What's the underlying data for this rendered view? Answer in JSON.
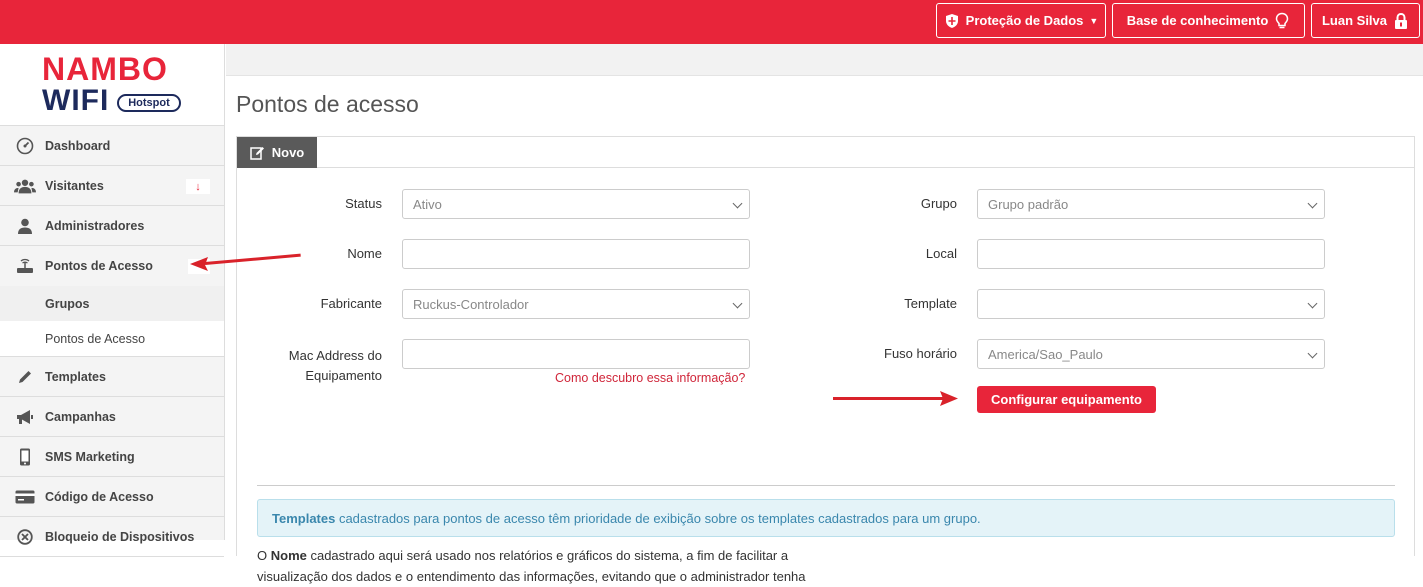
{
  "topbar": {
    "protecao_label": "Proteção de Dados",
    "base_label": "Base de conhecimento",
    "user_label": "Luan Silva"
  },
  "logo": {
    "brand_line1": "NAMBO",
    "brand_line2": "WIFI",
    "badge": "Hotspot"
  },
  "sidebar": {
    "items": [
      {
        "label": "Dashboard",
        "icon": "dashboard-icon"
      },
      {
        "label": "Visitantes",
        "icon": "users-icon",
        "badge": "↓"
      },
      {
        "label": "Administradores",
        "icon": "user-icon"
      },
      {
        "label": "Pontos de Acesso",
        "icon": "router-icon"
      },
      {
        "label": "Templates",
        "icon": "pencil-icon"
      },
      {
        "label": "Campanhas",
        "icon": "megaphone-icon"
      },
      {
        "label": "SMS Marketing",
        "icon": "phone-icon"
      },
      {
        "label": "Código de Acesso",
        "icon": "card-icon"
      },
      {
        "label": "Bloqueio de Dispositivos",
        "icon": "block-icon"
      }
    ],
    "subitems": [
      "Grupos",
      "Pontos de Acesso"
    ]
  },
  "page": {
    "title": "Pontos de acesso",
    "tab_label": "Novo"
  },
  "form": {
    "status_label": "Status",
    "status_value": "Ativo",
    "nome_label": "Nome",
    "nome_value": "",
    "fabricante_label": "Fabricante",
    "fabricante_value": "Ruckus-Controlador",
    "mac_label_1": "Mac Address do",
    "mac_label_2": "Equipamento",
    "mac_value": "",
    "mac_help_link": "Como descubro essa informação?",
    "grupo_label": "Grupo",
    "grupo_value": "Grupo padrão",
    "local_label": "Local",
    "local_value": "",
    "template_label": "Template",
    "template_value": "",
    "fuso_label": "Fuso horário",
    "fuso_value": "America/Sao_Paulo",
    "configure_button": "Configurar equipamento"
  },
  "info": {
    "alert_bold": "Templates",
    "alert_text": " cadastrados para pontos de acesso têm prioridade de exibição sobre os templates cadastrados para um grupo.",
    "para_prefix": "O ",
    "para_bold": "Nome",
    "para_text": " cadastrado aqui será usado nos relatórios e gráficos do sistema, a fim de facilitar a visualização dos dados e o entendimento das informações, evitando que o administrador tenha"
  },
  "colors": {
    "brand": "#e8253a",
    "tab": "#5a5a5a",
    "link": "#d0263a",
    "alert_bg": "#e4f3f8"
  }
}
